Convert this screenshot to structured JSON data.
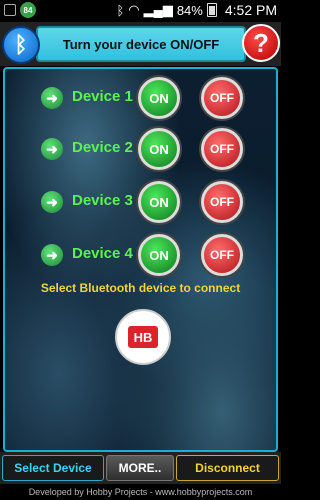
{
  "status_bar": {
    "badge": "84",
    "battery": "84%",
    "time": "4:52 PM"
  },
  "header": {
    "title": "Turn your device ON/OFF",
    "help_symbol": "?",
    "bt_symbol": "ᛒ"
  },
  "devices": [
    {
      "label": "Device 1",
      "on": "ON",
      "off": "OFF"
    },
    {
      "label": "Device 2",
      "on": "ON",
      "off": "OFF"
    },
    {
      "label": "Device 3",
      "on": "ON",
      "off": "OFF"
    },
    {
      "label": "Device 4",
      "on": "ON",
      "off": "OFF"
    }
  ],
  "main": {
    "select_text": "Select Bluetooth device to connect",
    "logo_text": "HB"
  },
  "bottom_bar": {
    "select_device": "Select Device",
    "more": "MORE..",
    "disconnect": "Disconnect"
  },
  "footer": {
    "text": "Developed by Hobby Projects - www.hobbyprojects.com"
  },
  "colors": {
    "accent_cyan": "#31c1df",
    "device_green": "#5df253",
    "highlight_yellow": "#f2d436",
    "off_red": "#b3141a"
  }
}
